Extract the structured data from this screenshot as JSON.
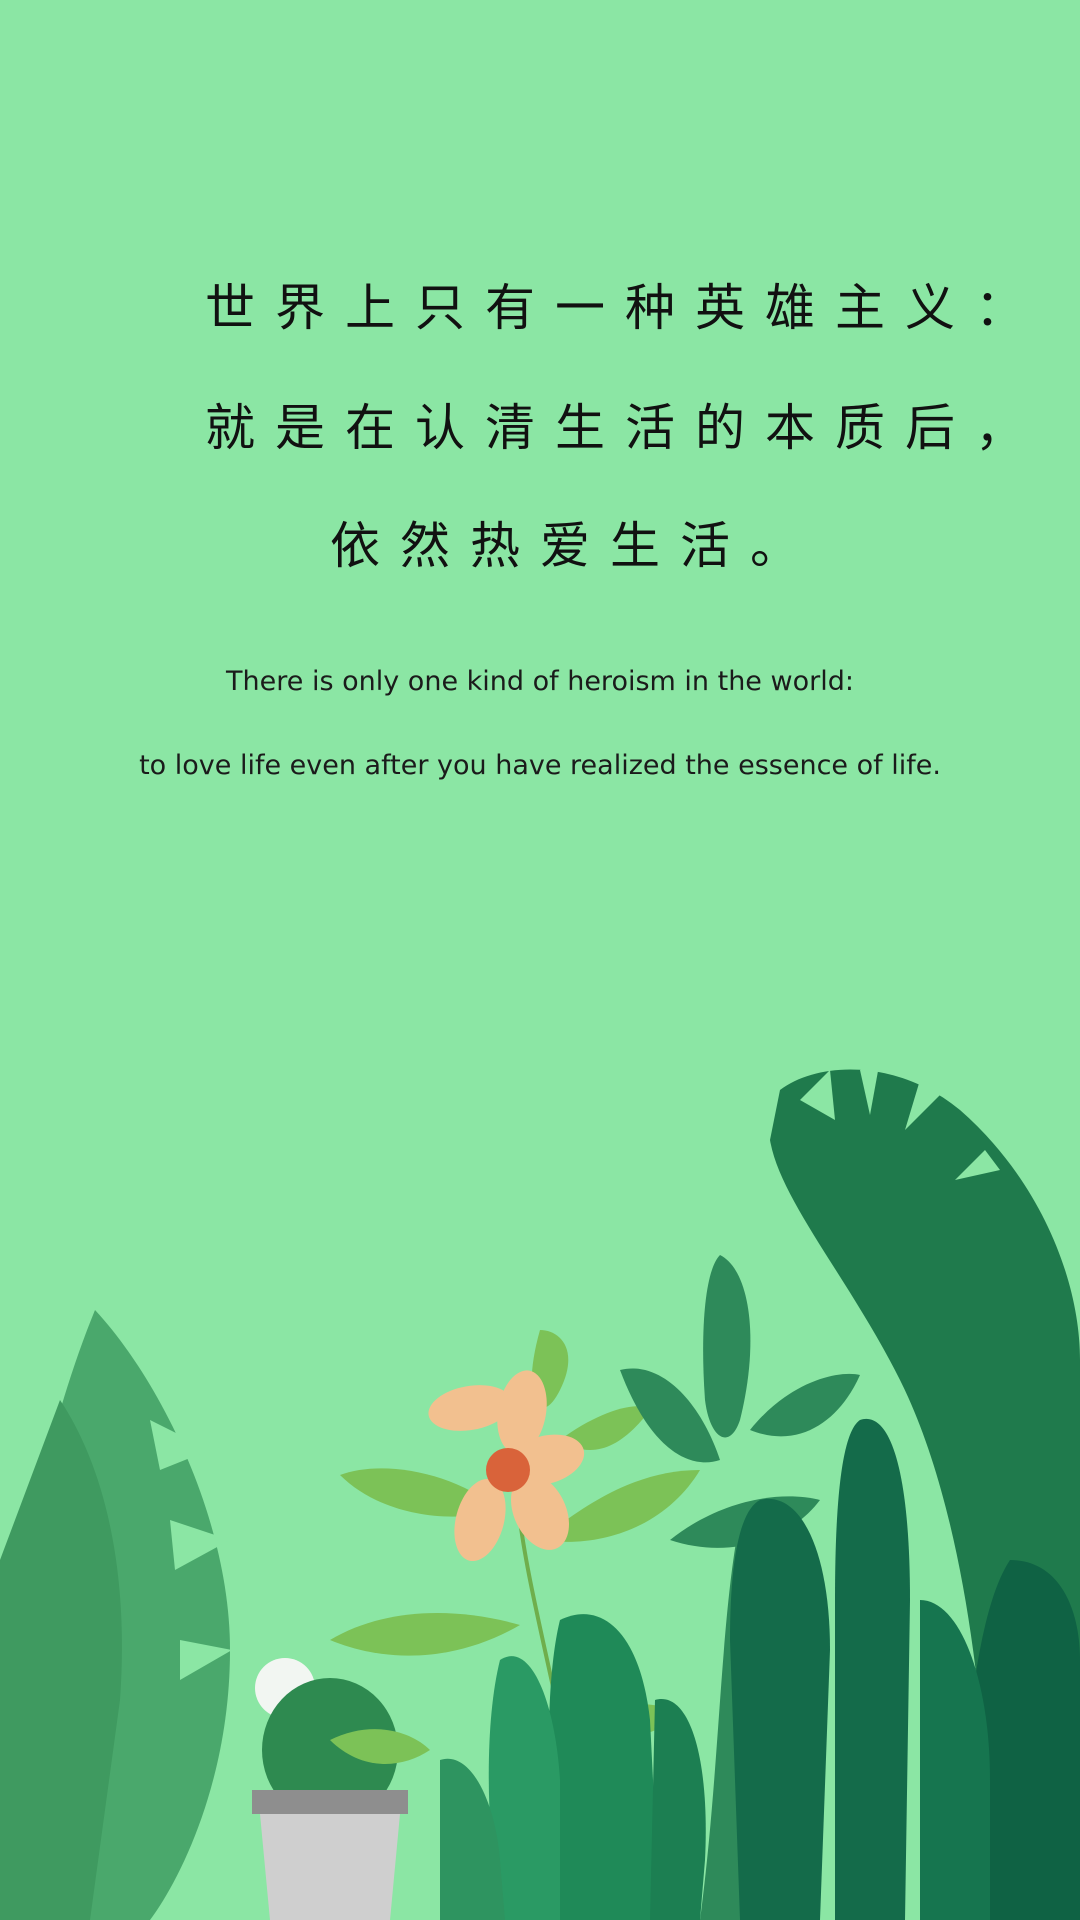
{
  "quote": {
    "chinese_lines": [
      "世界上只有一种英雄主义：",
      "就是在认清生活的本质后，",
      "依然热爱生活。"
    ],
    "english_lines": [
      "There is only one kind of heroism in the world:",
      "to love life even after you have realized the essence of life."
    ]
  },
  "illustration": {
    "description_icon": "plants-illustration",
    "colors": {
      "background": "#8be6a4",
      "dark_green": "#1f7a4c",
      "mid_green": "#2e9460",
      "light_green": "#7cc257",
      "flower_petal": "#f2c08f",
      "flower_center": "#d9633a",
      "pot": "#cfcfcf",
      "pot_rim": "#8e8e8e"
    }
  }
}
